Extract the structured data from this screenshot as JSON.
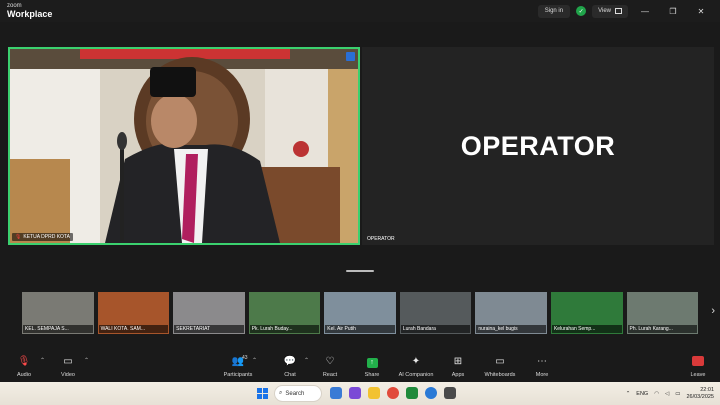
{
  "window": {
    "brand_small": "zoom",
    "brand_big": "Workplace",
    "signin_label": "Sign in",
    "view_label": "View",
    "minimize": "—",
    "maximize": "❐",
    "close": "✕"
  },
  "main": {
    "speaker_name": "KETUA DPRD KOTA",
    "operator_big_text": "OPERATOR",
    "operator_name": "OPERATOR"
  },
  "thumbnails": [
    {
      "name": "KEL. SEMPAJA S...",
      "bg": "#7a7a74"
    },
    {
      "name": "WALI KOTA. SAM...",
      "bg": "#a7552b"
    },
    {
      "name": "SEKRETARIAT",
      "bg": "#8b8a8c"
    },
    {
      "name": "Pk. Lurah Buday...",
      "bg": "#4d7a4a"
    },
    {
      "name": "Kel. Air Putih",
      "bg": "#7f8f9c"
    },
    {
      "name": "Lurah Bandara",
      "bg": "#555a5c"
    },
    {
      "name": "nuraina_kel bugis",
      "bg": "#7f8a93"
    },
    {
      "name": "Kelurahan Semp...",
      "bg": "#2f7a3a"
    },
    {
      "name": "Ph. Lurah Karang...",
      "bg": "#6d7a70"
    }
  ],
  "toolbar": {
    "audio": "Audio",
    "video": "Video",
    "participants": "Participants",
    "participants_count": "43",
    "chat": "Chat",
    "react": "React",
    "share": "Share",
    "ai_companion": "AI Companion",
    "apps": "Apps",
    "whiteboards": "Whiteboards",
    "more": "More",
    "leave": "Leave"
  },
  "taskbar": {
    "search_label": "Search",
    "language": "ENG",
    "time": "22:01",
    "date": "26/03/2025"
  },
  "colors": {
    "active_speaker_border": "#3bd16f",
    "share_green": "#22b04b",
    "leave_red": "#d93a3a"
  }
}
